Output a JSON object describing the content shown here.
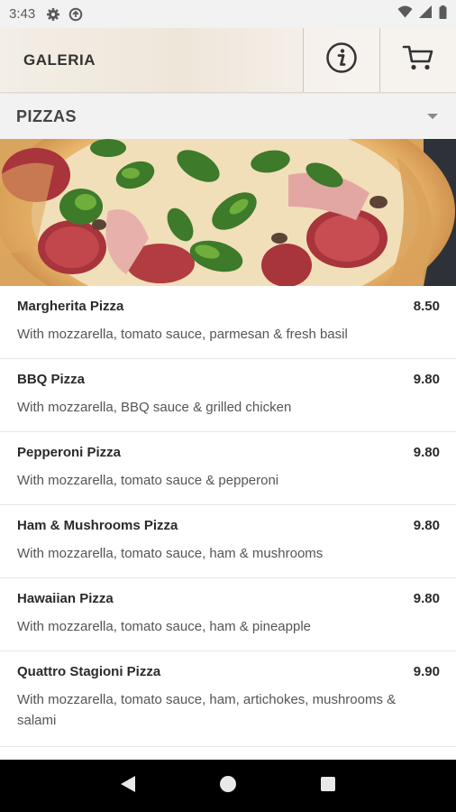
{
  "status_bar": {
    "time": "3:43"
  },
  "header": {
    "title": "GALERIA",
    "info_icon": "info-icon",
    "cart_icon": "cart-icon"
  },
  "category": {
    "label": "PIZZAS",
    "dropdown_icon": "chevron-down-icon"
  },
  "menu": {
    "items": [
      {
        "name": "Margherita Pizza",
        "price": "8.50",
        "description": "With mozzarella, tomato sauce, parmesan & fresh basil"
      },
      {
        "name": "BBQ Pizza",
        "price": "9.80",
        "description": "With mozzarella, BBQ sauce & grilled chicken"
      },
      {
        "name": "Pepperoni Pizza",
        "price": "9.80",
        "description": "With mozzarella, tomato sauce & pepperoni"
      },
      {
        "name": "Ham & Mushrooms Pizza",
        "price": "9.80",
        "description": "With mozzarella, tomato sauce, ham & mushrooms"
      },
      {
        "name": "Hawaiian Pizza",
        "price": "9.80",
        "description": "With mozzarella, tomato sauce, ham & pineapple"
      },
      {
        "name": "Quattro Stagioni Pizza",
        "price": "9.90",
        "description": "With mozzarella, tomato sauce, ham, artichokes, mushrooms & salami"
      }
    ]
  },
  "nav": {
    "back_icon": "back-icon",
    "home_icon": "home-icon",
    "recents_icon": "recents-icon"
  }
}
